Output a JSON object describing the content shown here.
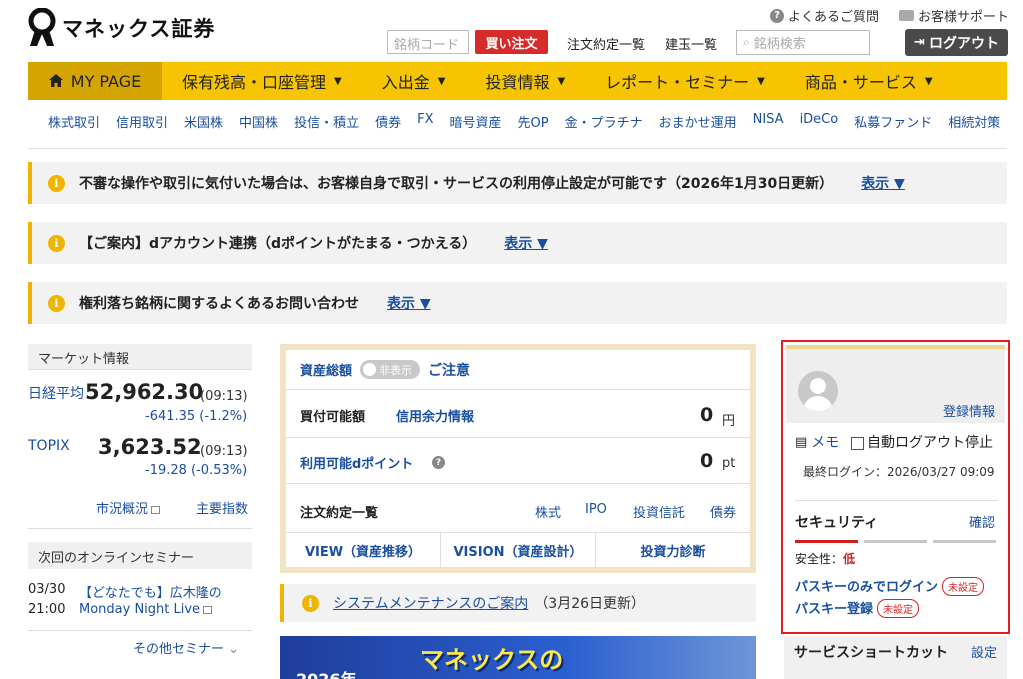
{
  "header": {
    "logo_text": "マネックス証券",
    "faq_label": "よくあるご質問",
    "support_label": "お客様サポート",
    "code_placeholder": "銘柄コード",
    "buy_label": "買い注文",
    "order_list": "注文約定一覧",
    "position_list": "建玉一覧",
    "search_placeholder": "銘柄検索",
    "logout_label": "ログアウト"
  },
  "main_nav": {
    "mypage": "MY PAGE",
    "items": [
      "保有残高・口座管理",
      "入出金",
      "投資情報",
      "レポート・セミナー",
      "商品・サービス"
    ]
  },
  "sub_nav": [
    "株式取引",
    "信用取引",
    "米国株",
    "中国株",
    "投信・積立",
    "債券",
    "FX",
    "暗号資産",
    "先OP",
    "金・プラチナ",
    "おまかせ運用",
    "NISA",
    "iDeCo",
    "私募ファンド",
    "相続対策"
  ],
  "notices": [
    {
      "text": "不審な操作や取引に気付いた場合は、お客様自身で取引・サービスの利用停止設定が可能です（2026年1月30日更新）",
      "link": "表示 ▼"
    },
    {
      "text": "【ご案内】dアカウント連携（dポイントがたまる・つかえる）",
      "link": "表示 ▼"
    },
    {
      "text": "権利落ち銘柄に関するよくあるお問い合わせ",
      "link": "表示 ▼"
    }
  ],
  "market": {
    "title": "マーケット情報",
    "nikkei": {
      "name": "日経平均",
      "value": "52,962.30",
      "time": "(09:13)",
      "change": "-641.35 (-1.2%)"
    },
    "topix": {
      "name": "TOPIX",
      "value": "3,623.52",
      "time": "(09:13)",
      "change": "-19.28 (-0.53%)"
    },
    "overview_link": "市況概況",
    "indices_link": "主要指数"
  },
  "seminar": {
    "title": "次回のオンラインセミナー",
    "date": "03/30",
    "time": "21:00",
    "line1": "【どなたでも】広木隆の",
    "line2": "Monday Night Live",
    "more": "その他セミナー"
  },
  "assets": {
    "total_label": "資産総額",
    "toggle_label": "非表示",
    "caution": "ご注意",
    "buying_power_label": "買付可能額",
    "credit_link": "信用余力情報",
    "buying_power_value": "0",
    "yen": "円",
    "dpoint_label": "利用可能dポイント",
    "dpoint_value": "0",
    "pt": "pt",
    "orders_label": "注文約定一覧",
    "order_tabs": [
      "株式",
      "IPO",
      "投資信託",
      "債券"
    ],
    "bottom_tabs": [
      "VIEW（資産推移）",
      "VISION（資産設計）",
      "投資力診断"
    ]
  },
  "maintenance": {
    "link": "システムメンテナンスのご案内",
    "date": "（3月26日更新）"
  },
  "banner": {
    "title": "マネックスの",
    "year": "2026年"
  },
  "account": {
    "reg_info": "登録情報",
    "memo": "メモ",
    "auto_logout": "自動ログアウト停止",
    "last_login": "最終ログイン：2026/03/27 09:09",
    "security_title": "セキュリティ",
    "confirm": "確認",
    "safety_label": "安全性：",
    "safety_value": "低",
    "passkey_only": "パスキーのみでログイン",
    "passkey_reg": "パスキー登録",
    "unset": "未設定"
  },
  "shortcut": {
    "title": "サービスショートカット",
    "settings": "設定"
  },
  "colors": {
    "nav_yellow": "#f6c400",
    "buy_red": "#d52b2b",
    "link_blue": "#1a4fa0",
    "alert_red": "#e02020"
  }
}
